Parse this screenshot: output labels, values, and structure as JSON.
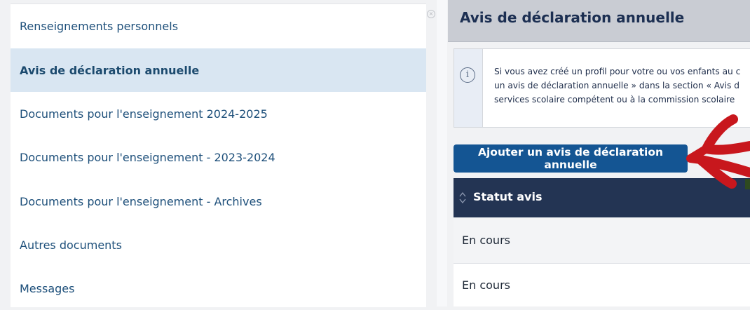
{
  "sidebar": {
    "items": [
      {
        "label": "Renseignements personnels",
        "active": false
      },
      {
        "label": "Avis de déclaration annuelle",
        "active": true
      },
      {
        "label": "Documents pour l'enseignement 2024-2025",
        "active": false
      },
      {
        "label": "Documents pour l'enseignement - 2023-2024",
        "active": false
      },
      {
        "label": "Documents pour l'enseignement - Archives",
        "active": false
      },
      {
        "label": "Autres documents",
        "active": false
      },
      {
        "label": "Messages",
        "active": false
      }
    ]
  },
  "main": {
    "title": "Avis de déclaration annuelle",
    "info": {
      "icon": "info-icon",
      "lines": [
        "Si vous avez créé un profil pour votre ou vos enfants au c",
        "un avis de déclaration annuelle » dans la section « Avis d",
        "services scolaire compétent ou à la commission scolaire"
      ]
    },
    "add_button_label": "Ajouter un avis de déclaration annuelle",
    "table": {
      "column_header": "Statut avis",
      "rows": [
        "En cours",
        "En cours"
      ]
    }
  },
  "colors": {
    "primary_button": "#145593",
    "table_header": "#233453",
    "active_nav": "#d9e6f2",
    "annotation_arrow": "#c8171d"
  }
}
